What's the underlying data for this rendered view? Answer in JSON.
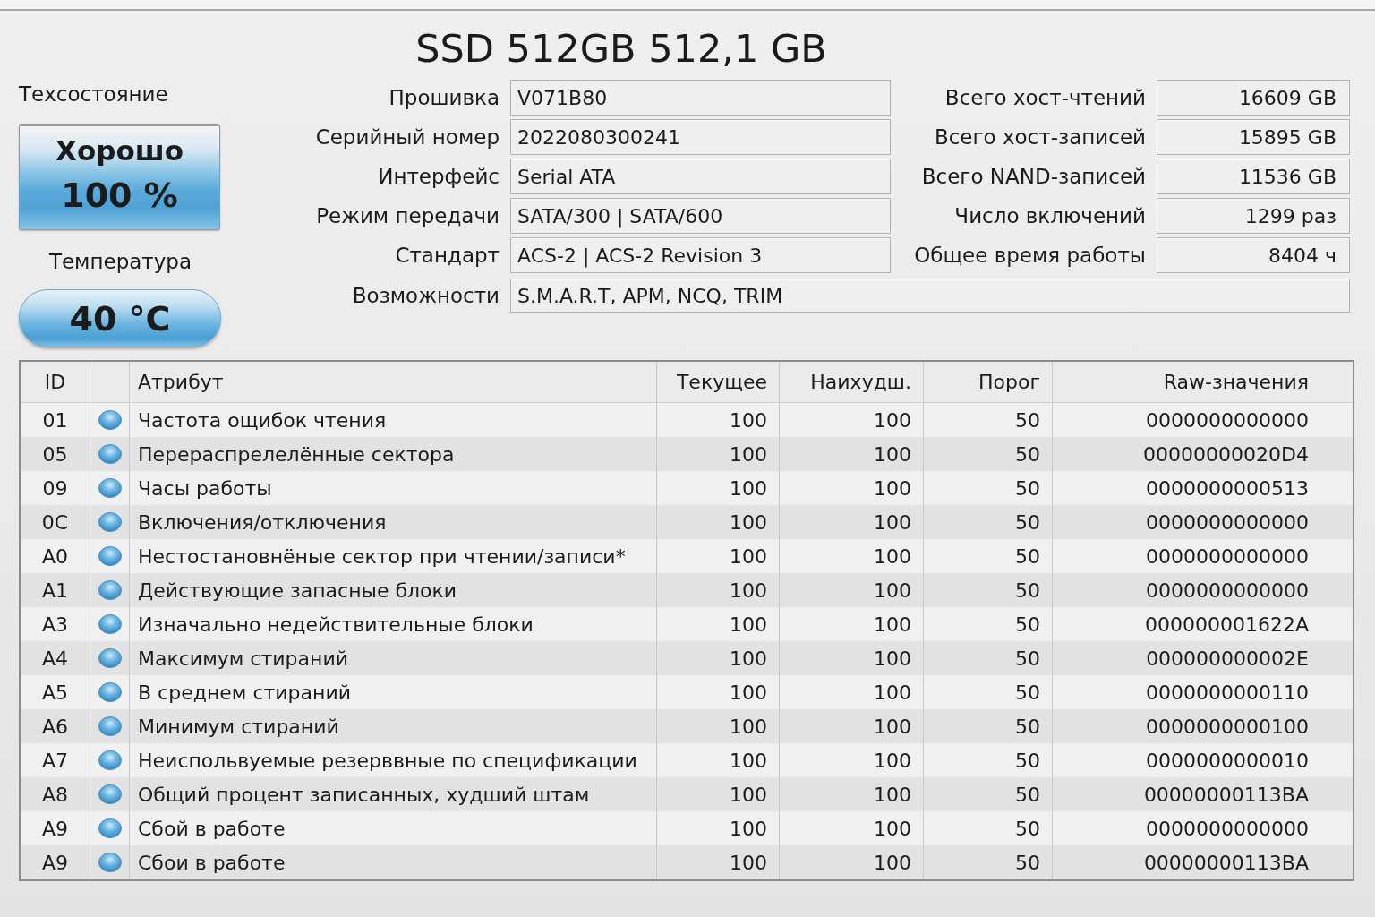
{
  "title": "SSD 512GB 512,1 GB",
  "health": {
    "label": "Техсостояние",
    "status": "Хорошо",
    "percent": "100 %"
  },
  "temperature": {
    "label": "Температура",
    "value": "40 °C"
  },
  "info_left": [
    {
      "label": "Прошивка",
      "value": "V071B80"
    },
    {
      "label": "Серийный номер",
      "value": "2022080300241"
    },
    {
      "label": "Интерфейс",
      "value": "Serial ATA"
    },
    {
      "label": "Режим передачи",
      "value": "SATA/300 | SATA/600"
    },
    {
      "label": "Стандарт",
      "value": "ACS-2 | ACS-2 Revision 3"
    }
  ],
  "info_right": [
    {
      "label": "Всего хост-чтений",
      "value": "16609 GB"
    },
    {
      "label": "Всего хост-записей",
      "value": "15895 GB"
    },
    {
      "label": "Всего NAND-записей",
      "value": "11536 GB"
    },
    {
      "label": "Число включений",
      "value": "1299 раз"
    },
    {
      "label": "Общее время работы",
      "value": "8404 ч"
    }
  ],
  "features": {
    "label": "Возможности",
    "value": "S.M.A.R.T, APM, NCQ, TRIM"
  },
  "smart_table": {
    "columns": [
      "ID",
      "Атрибут",
      "Текущее",
      "Наихудш.",
      "Порог",
      "Raw-значения"
    ],
    "rows": [
      {
        "id": "01",
        "attribute": "Частота ощибок чтения",
        "current": "100",
        "worst": "100",
        "threshold": "50",
        "raw": "0000000000000"
      },
      {
        "id": "05",
        "attribute": "Перераспрелелённые сектора",
        "current": "100",
        "worst": "100",
        "threshold": "50",
        "raw": "00000000020D4"
      },
      {
        "id": "09",
        "attribute": "Часы работы",
        "current": "100",
        "worst": "100",
        "threshold": "50",
        "raw": "0000000000513"
      },
      {
        "id": "0C",
        "attribute": "Включения/отключения",
        "current": "100",
        "worst": "100",
        "threshold": "50",
        "raw": "0000000000000"
      },
      {
        "id": "A0",
        "attribute": "Нестостановнёные сектор при чтении/записи*",
        "current": "100",
        "worst": "100",
        "threshold": "50",
        "raw": "0000000000000"
      },
      {
        "id": "A1",
        "attribute": "Действующие запасные блоки",
        "current": "100",
        "worst": "100",
        "threshold": "50",
        "raw": "0000000000000"
      },
      {
        "id": "A3",
        "attribute": "Изначально недействительные блоки",
        "current": "100",
        "worst": "100",
        "threshold": "50",
        "raw": "000000001622A"
      },
      {
        "id": "A4",
        "attribute": "Максимум стираний",
        "current": "100",
        "worst": "100",
        "threshold": "50",
        "raw": "000000000002E"
      },
      {
        "id": "A5",
        "attribute": "В среднем стираний",
        "current": "100",
        "worst": "100",
        "threshold": "50",
        "raw": "0000000000110"
      },
      {
        "id": "A6",
        "attribute": "Минимум стираний",
        "current": "100",
        "worst": "100",
        "threshold": "50",
        "raw": "0000000000100"
      },
      {
        "id": "A7",
        "attribute": "Неиспольвуемые резерввные по спецификации",
        "current": "100",
        "worst": "100",
        "threshold": "50",
        "raw": "0000000000010"
      },
      {
        "id": "A8",
        "attribute": "Общий процент записанных, худший штам",
        "current": "100",
        "worst": "100",
        "threshold": "50",
        "raw": "00000000113BA"
      },
      {
        "id": "A9",
        "attribute": "Сбой в работе",
        "current": "100",
        "worst": "100",
        "threshold": "50",
        "raw": "0000000000000"
      },
      {
        "id": "A9",
        "attribute": "Сбои в работе",
        "current": "100",
        "worst": "100",
        "threshold": "50",
        "raw": "00000000113BA"
      }
    ]
  }
}
